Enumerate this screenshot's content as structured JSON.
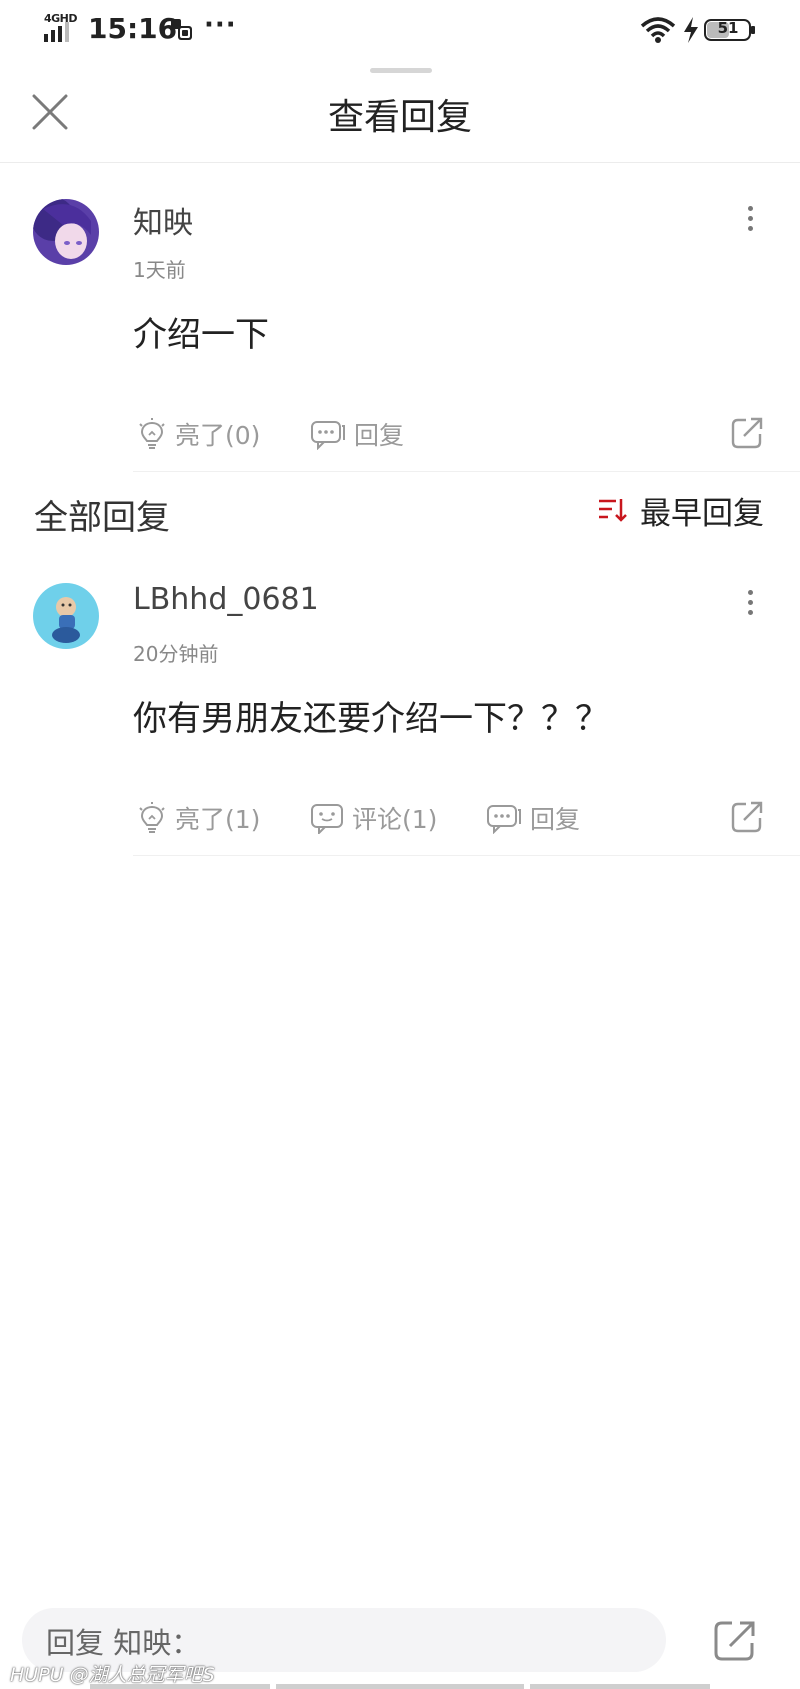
{
  "status_bar": {
    "network": "4GHD",
    "time": "15:16",
    "more": "···",
    "battery": "51"
  },
  "header": {
    "title": "查看回复"
  },
  "original_comment": {
    "username": "知映",
    "time": "1天前",
    "content": "介绍一下",
    "like_label": "亮了(0)",
    "reply_label": "回复"
  },
  "replies_section": {
    "title": "全部回复",
    "sort_label": "最早回复",
    "sort_color": "#c8161d"
  },
  "replies": [
    {
      "username": "LBhhd_0681",
      "time": "20分钟前",
      "content": "你有男朋友还要介绍一下？？？",
      "like_label": "亮了(1)",
      "comment_label": "评论(1)",
      "reply_label": "回复"
    }
  ],
  "bottom_bar": {
    "reply_placeholder": "回复 知映：",
    "watermark": "HUPU @湖人总冠军吧S"
  }
}
